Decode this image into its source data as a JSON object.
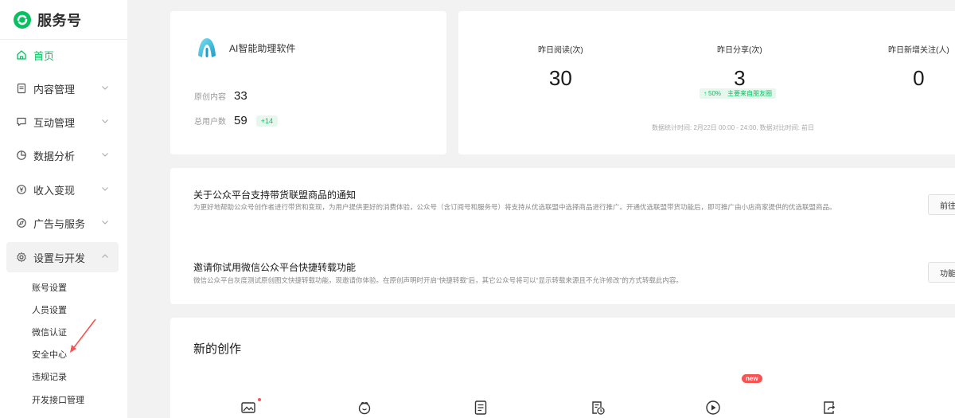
{
  "brand": {
    "name": "服务号",
    "logo": "wechat-service-logo"
  },
  "colors": {
    "accent": "#07c160",
    "danger": "#fa5151"
  },
  "sidebar": {
    "items": [
      {
        "label": "首页",
        "icon": "home-icon",
        "active": true
      },
      {
        "label": "内容管理",
        "icon": "document-icon"
      },
      {
        "label": "互动管理",
        "icon": "chat-icon"
      },
      {
        "label": "数据分析",
        "icon": "pie-chart-icon"
      },
      {
        "label": "收入变现",
        "icon": "yen-icon"
      },
      {
        "label": "广告与服务",
        "icon": "compass-icon"
      },
      {
        "label": "设置与开发",
        "icon": "gear-icon",
        "expanded": true
      }
    ],
    "sub_items": [
      "账号设置",
      "人员设置",
      "微信认证",
      "安全中心",
      "违规记录",
      "开发接口管理"
    ]
  },
  "account": {
    "name": "AI智能助理软件",
    "original_label": "原创内容",
    "original_value": "33",
    "users_label": "总用户数",
    "users_value": "59",
    "users_delta": "+14"
  },
  "stats": {
    "items": [
      {
        "label": "昨日阅读(次)",
        "value": "30"
      },
      {
        "label": "昨日分享(次)",
        "value": "3"
      },
      {
        "label": "昨日新增关注(人)",
        "value": "0"
      }
    ],
    "share_change": {
      "arrow": "↑",
      "percent": "50%",
      "source": "主要来自朋友圈"
    },
    "note": "数据统计时间: 2月22日 00:00 - 24:00, 数据对比时间: 前日"
  },
  "notices": [
    {
      "title": "关于公众平台支持带货联盟商品的通知",
      "desc": "为更好地帮助公众号创作者进行带货和变现，为用户提供更好的消费体验，公众号（含订阅号和服务号）将支持从优选联盟中选择商品进行推广。开通优选联盟带货功能后，即可推广由小店商家提供的优选联盟商品。",
      "button": "前往"
    },
    {
      "title": "邀请你试用微信公众平台快捷转载功能",
      "desc": "微信公众平台灰度测试原创图文快捷转载功能，现邀请你体验。在原创声明时开启“快捷转载”后，其它公众号将可以“显示转载来源且不允许修改”的方式转载此内容。",
      "button": "功能"
    }
  ],
  "create": {
    "title": "新的创作",
    "new_badge": "new",
    "tools": [
      "image-post-icon",
      "audio-icon",
      "article-icon",
      "repost-icon",
      "video-icon",
      "share-icon"
    ]
  }
}
